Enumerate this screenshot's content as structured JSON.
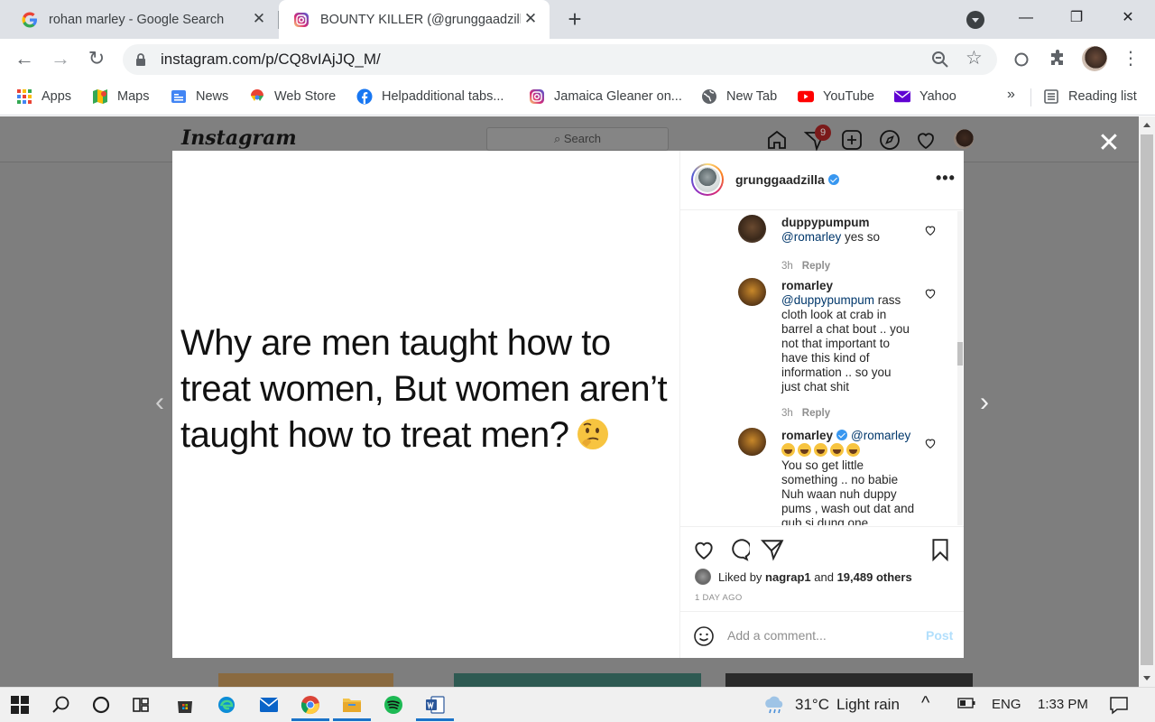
{
  "browser": {
    "tabs": [
      {
        "title": "rohan marley - Google Search",
        "icon": "google-icon"
      },
      {
        "title": "BOUNTY KILLER (@grunggaadzilla",
        "icon": "instagram-icon",
        "active": true
      }
    ],
    "url": "instagram.com/p/CQ8vIAjJQ_M/",
    "bookmarks": [
      {
        "label": "Apps",
        "icon": "apps-grid-icon"
      },
      {
        "label": "Maps",
        "icon": "maps-icon"
      },
      {
        "label": "News",
        "icon": "news-icon"
      },
      {
        "label": "Web Store",
        "icon": "webstore-icon"
      },
      {
        "label": "Helpadditional tabs...",
        "icon": "facebook-icon"
      },
      {
        "label": "Jamaica Gleaner on...",
        "icon": "instagram-icon"
      },
      {
        "label": "New Tab",
        "icon": "globe-icon"
      },
      {
        "label": "YouTube",
        "icon": "youtube-icon"
      },
      {
        "label": "Yahoo",
        "icon": "yahoo-mail-icon"
      }
    ],
    "more_bookmarks": "»",
    "reading_list": "Reading list"
  },
  "instagram": {
    "logo": "Instagram",
    "search_placeholder": "Search",
    "notification_count": "9",
    "post": {
      "image_text": "Why are men taught how to treat women, But women aren’t taught how to treat men?",
      "author": "grunggaadzilla",
      "comments": [
        {
          "user": "duppypumpum",
          "mention": "@romarley",
          "text": "yes so",
          "time": "3h",
          "reply": "Reply"
        },
        {
          "user": "romarley",
          "mention": "@duppypumpum",
          "text": "rass cloth look at crab in barrel a chat bout .. you not that important to have this kind of information .. so you just chat shit",
          "time": "3h",
          "reply": "Reply"
        },
        {
          "user": "romarley",
          "mention": "@romarley",
          "text": "You so get little something .. no babie Nuh waan nuh duppy pums , wash out dat and gub si dung one",
          "verified": true
        }
      ],
      "liked_by_prefix": "Liked by",
      "liked_by_user": "nagrap1",
      "liked_by_and": "and",
      "liked_by_count": "19,489 others",
      "time_ago": "1 DAY AGO",
      "comment_placeholder": "Add a comment...",
      "post_button": "Post"
    }
  },
  "taskbar": {
    "weather_temp": "31°C",
    "weather_desc": "Light rain",
    "language": "ENG",
    "clock": "1:33 PM"
  },
  "colors": {
    "instagram_link": "#00376b",
    "verified_blue": "#3897f0",
    "post_button_disabled": "#b2dffc"
  }
}
